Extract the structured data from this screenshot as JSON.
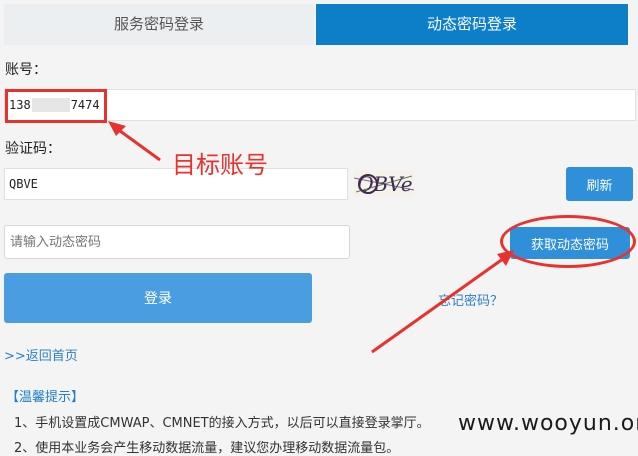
{
  "tabs": {
    "service_password_label": "服务密码登录",
    "dynamic_password_label": "动态密码登录"
  },
  "account": {
    "label": "账号：",
    "value_prefix": "138",
    "value_suffix": "7474"
  },
  "captcha": {
    "label": "验证码：",
    "value": "QBVE",
    "image_text": "QBVe",
    "refresh_label": "刷新"
  },
  "dynamic_password": {
    "placeholder": "请输入动态密码",
    "get_button_label": "获取动态密码"
  },
  "login_button_label": "登录",
  "forgot_password_label": "忘记密码？",
  "back_home_label": ">>返回首页",
  "tips": {
    "title": "【温馨提示】",
    "items": [
      "1、手机设置成CMWAP、CMNET的接入方式，以后可以直接登录掌厅。",
      "2、使用本业务会产生移动数据流量，建议您办理移动数据流量包。"
    ]
  },
  "annotation": {
    "text": "目标账号",
    "color": "#e8322f"
  },
  "watermark": "www.wooyun.org",
  "colors": {
    "active_tab": "#0c7fc8",
    "button": "#2f8fd8",
    "login_button": "#4a9de0",
    "link": "#2b7fc7"
  }
}
